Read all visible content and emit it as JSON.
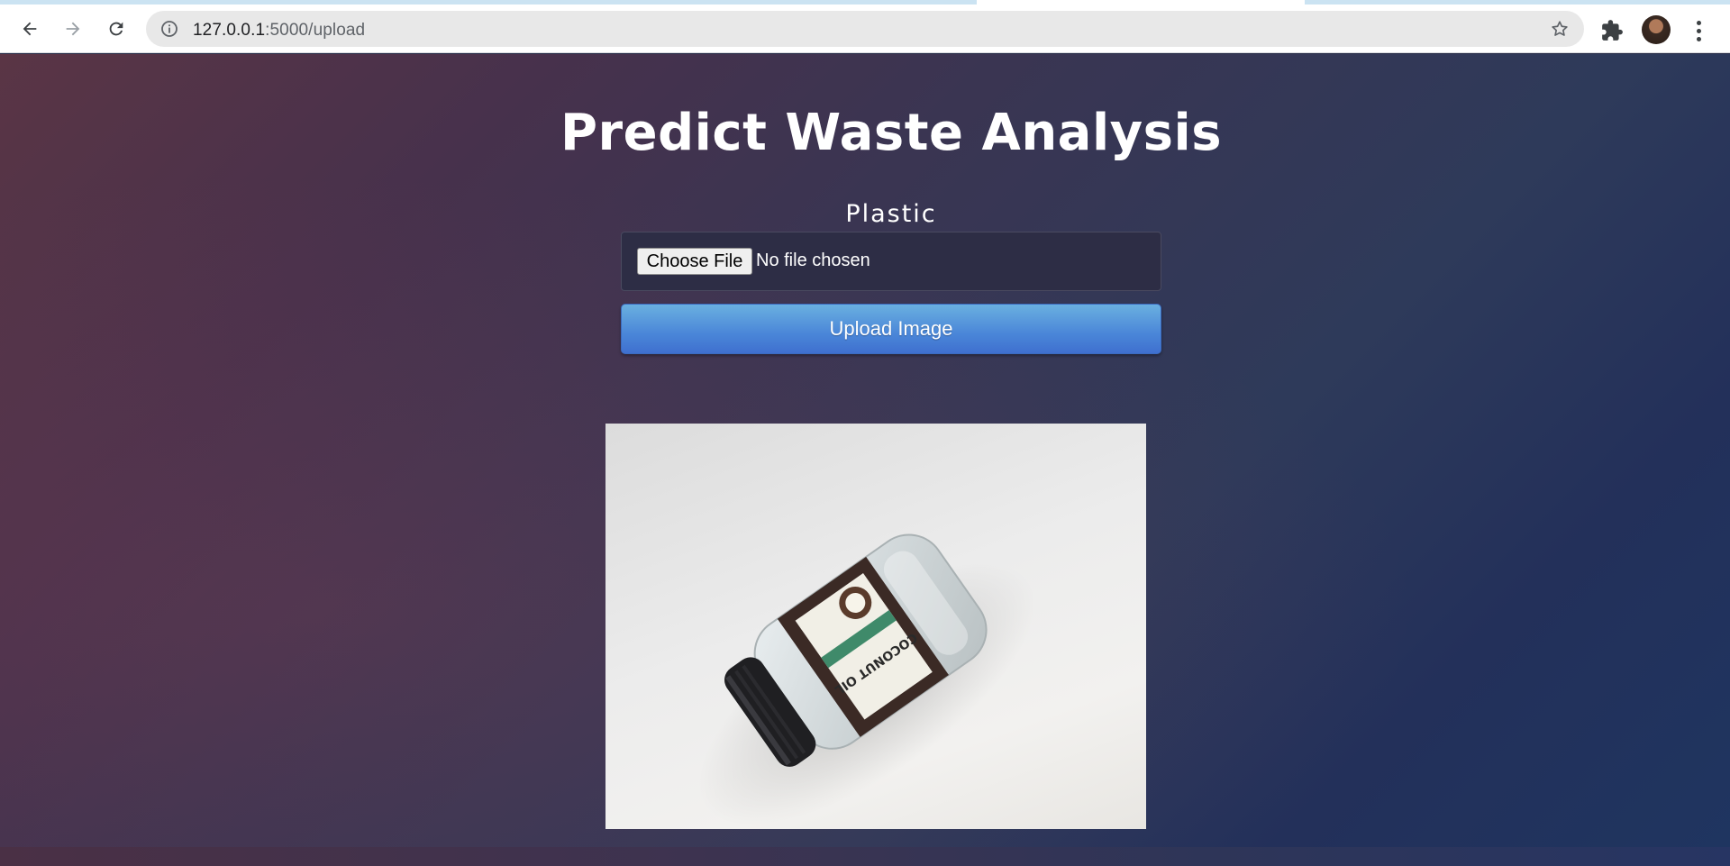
{
  "browser": {
    "url_host": "127.0.0.1",
    "url_path": ":5000/upload"
  },
  "page": {
    "title": "Predict Waste Analysis",
    "prediction": "Plastic",
    "file_input": {
      "button_label": "Choose File",
      "status": "No file chosen"
    },
    "upload_button_label": "Upload Image"
  }
}
